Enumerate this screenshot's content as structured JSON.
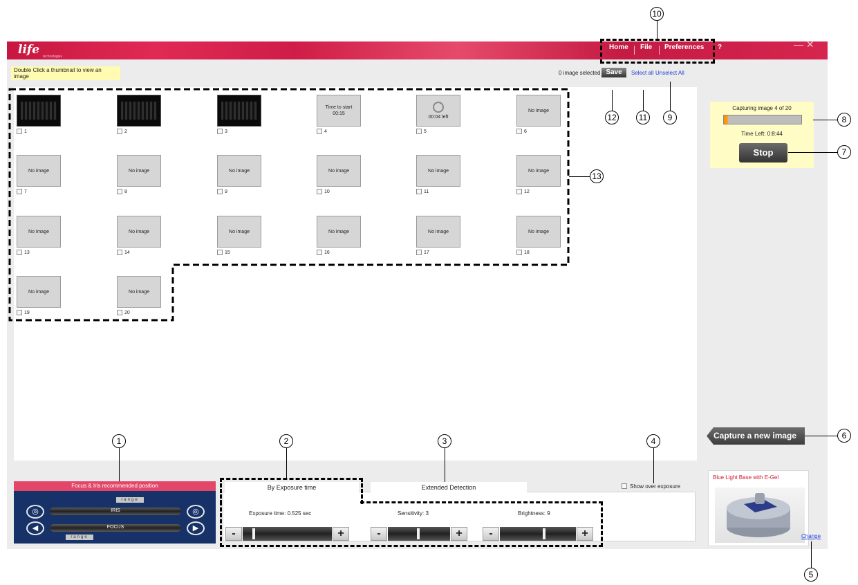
{
  "titlebar": {
    "logo": "life",
    "logo_sub": "technologies",
    "menu": [
      "Home",
      "File",
      "Preferences",
      "?"
    ],
    "window_controls": "— ✕"
  },
  "hint": "Double Click a thumbnail to view an image",
  "toolbar": {
    "selected_text": "0 image selected",
    "save_label": "Save",
    "select_all": "Select all",
    "unselect_all": "Unselect All"
  },
  "thumbnails": [
    {
      "n": "1",
      "type": "image",
      "text": ""
    },
    {
      "n": "2",
      "type": "image",
      "text": ""
    },
    {
      "n": "3",
      "type": "image",
      "text": ""
    },
    {
      "n": "4",
      "type": "pending",
      "text": "Time to start 00:15"
    },
    {
      "n": "5",
      "type": "capturing",
      "text": "00:04 left"
    },
    {
      "n": "6",
      "type": "empty",
      "text": "No image"
    },
    {
      "n": "7",
      "type": "empty",
      "text": "No image"
    },
    {
      "n": "8",
      "type": "empty",
      "text": "No image"
    },
    {
      "n": "9",
      "type": "empty",
      "text": "No image"
    },
    {
      "n": "10",
      "type": "empty",
      "text": "No image"
    },
    {
      "n": "11",
      "type": "empty",
      "text": "No image"
    },
    {
      "n": "12",
      "type": "empty",
      "text": "No image"
    },
    {
      "n": "13",
      "type": "empty",
      "text": "No image"
    },
    {
      "n": "14",
      "type": "empty",
      "text": "No image"
    },
    {
      "n": "15",
      "type": "empty",
      "text": "No image"
    },
    {
      "n": "16",
      "type": "empty",
      "text": "No image"
    },
    {
      "n": "17",
      "type": "empty",
      "text": "No image"
    },
    {
      "n": "18",
      "type": "empty",
      "text": "No image"
    },
    {
      "n": "19",
      "type": "empty",
      "text": "No image"
    },
    {
      "n": "20",
      "type": "empty",
      "text": "No image"
    }
  ],
  "progress": {
    "title": "Capturing image 4 of 20",
    "fraction": 0.05,
    "time_left": "Time Left: 0:8:44",
    "stop_label": "Stop"
  },
  "capture_label": "Capture a new image",
  "base": {
    "title": "Blue Light Base with E-Gel",
    "change_label": "Change"
  },
  "focus": {
    "title": "Focus & Iris recommended position",
    "iris_label": "IRIS",
    "focus_label": "FOCUS",
    "range_label": "range"
  },
  "tabs": {
    "exposure": "By Exposure time",
    "extended": "Extended Detection"
  },
  "show_over_exposure": "Show over exposure",
  "controls": {
    "exposure": "Exposure time: 0.525 sec",
    "sensitivity": "Sensitivity: 3",
    "brightness": "Brightness: 9",
    "minus": "-",
    "plus": "+"
  },
  "callouts": [
    "1",
    "2",
    "3",
    "4",
    "5",
    "6",
    "7",
    "8",
    "9",
    "10",
    "11",
    "12",
    "13"
  ],
  "colors": {
    "brand": "#d21f4a",
    "hint_bg": "#fffbb0",
    "focus_panel": "#173268"
  }
}
